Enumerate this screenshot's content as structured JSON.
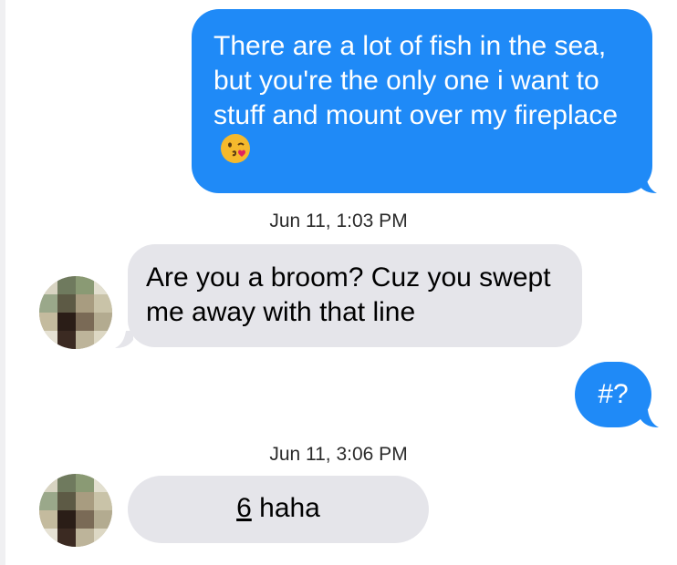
{
  "conversation": {
    "messages": [
      {
        "direction": "sent",
        "text": "There are a lot of fish in the sea, but you're the only one i want to stuff and mount over my fireplace",
        "emoji": "kissing-face-with-heart"
      },
      {
        "direction": "received",
        "timestamp": "Jun 11, 1:03 PM",
        "text": "Are you a broom? Cuz you swept me away with that line"
      },
      {
        "direction": "sent",
        "text": "#?"
      },
      {
        "direction": "received",
        "timestamp": "Jun 11, 3:06 PM",
        "text_underlined": "6",
        "text_rest": " haha"
      }
    ]
  },
  "colors": {
    "sent_bubble": "#1f8af7",
    "received_bubble": "#e5e5ea",
    "timestamp_text": "#2b2b2b"
  }
}
